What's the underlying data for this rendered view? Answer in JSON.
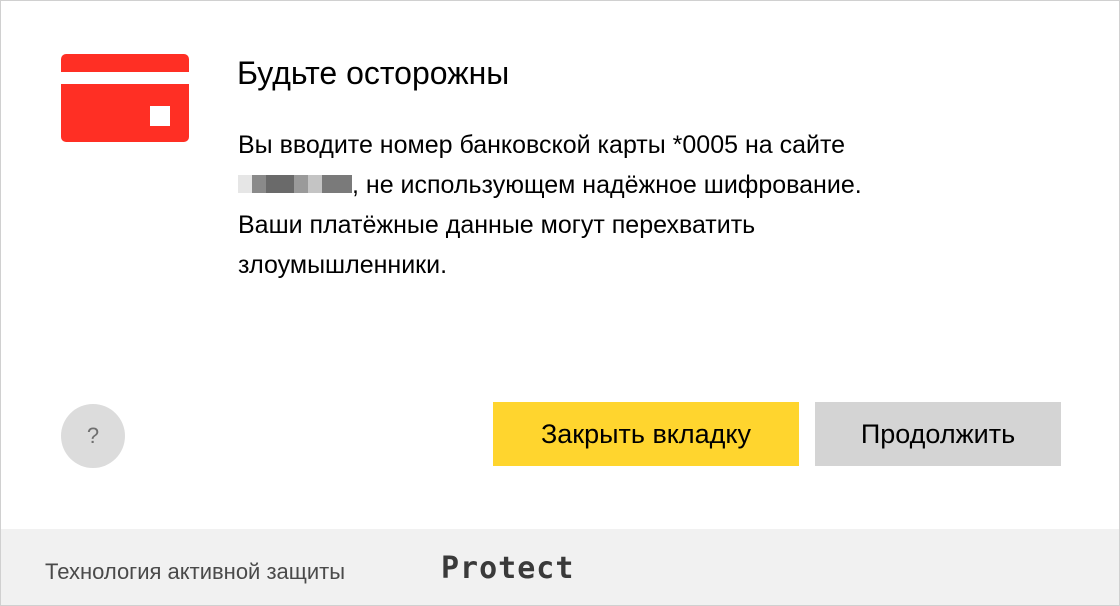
{
  "dialog": {
    "icon": "credit-card-icon",
    "title": "Будьте осторожны",
    "message": {
      "line1": "Вы вводите номер банковской карты *0005 на сайте",
      "line2_suffix": ", не использующем надёжное шифрование.",
      "line3": "Ваши платёжные данные могут перехватить",
      "line4": "злоумышленники."
    },
    "help_label": "?",
    "buttons": {
      "close_tab": "Закрыть вкладку",
      "continue": "Продолжить"
    }
  },
  "footer": {
    "text": "Технология активной защиты",
    "brand": "Protect"
  },
  "colors": {
    "card_red": "#ff2f24",
    "primary_button": "#ffd52e",
    "secondary_button": "#d4d4d4",
    "footer_bg": "#f1f1f1"
  }
}
